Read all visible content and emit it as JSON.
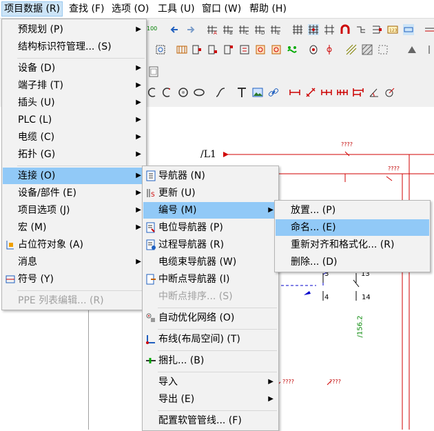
{
  "menubar": [
    {
      "label": "项目数据 (R)",
      "active": true
    },
    {
      "label": "查找 (F)"
    },
    {
      "label": "选项 (O)"
    },
    {
      "label": "工具 (U)"
    },
    {
      "label": "窗口 (W)"
    },
    {
      "label": "帮助 (H)"
    }
  ],
  "menu1": [
    {
      "label": "预规划 (P)",
      "sub": true
    },
    {
      "label": "结构标识符管理... (S)"
    },
    {
      "label": "设备 (D)",
      "sub": true
    },
    {
      "label": "端子排 (T)",
      "sub": true
    },
    {
      "label": "插头 (U)",
      "sub": true
    },
    {
      "label": "PLC (L)",
      "sub": true
    },
    {
      "label": "电缆 (C)",
      "sub": true
    },
    {
      "label": "拓扑 (G)",
      "sub": true
    },
    {
      "label": "连接 (O)",
      "sub": true,
      "highlighted": true
    },
    {
      "label": "设备/部件 (E)",
      "sub": true
    },
    {
      "label": "项目选项 (J)",
      "sub": true
    },
    {
      "label": "宏 (M)",
      "sub": true
    },
    {
      "label": "占位符对象 (A)",
      "icon": "placeholder-object-icon"
    },
    {
      "label": "消息",
      "sub": true
    },
    {
      "label": "符号 (Y)",
      "icon": "symbol-icon"
    },
    {
      "label": "PPE 列表编辑... (R)",
      "disabled": true
    }
  ],
  "menu2": [
    {
      "label": "导航器 (N)",
      "icon": "navigator-icon"
    },
    {
      "label": "更新 (U)",
      "icon": "update-icon"
    },
    {
      "label": "编号 (M)",
      "sub": true,
      "highlighted": true
    },
    {
      "label": "电位导航器 (P)",
      "icon": "potential-navigator-icon"
    },
    {
      "label": "过程导航器 (R)",
      "icon": "process-navigator-icon"
    },
    {
      "label": "电缆束导航器 (W)"
    },
    {
      "label": "中断点导航器 (I)",
      "icon": "interruption-point-icon"
    },
    {
      "label": "中断点排序... (S)",
      "disabled": true
    },
    {
      "label": "自动优化网络 (O)",
      "icon": "optimize-network-icon"
    },
    {
      "label": "布线(布局空间) (T)",
      "icon": "routing-icon"
    },
    {
      "label": "捆扎... (B)",
      "icon": "bundle-icon"
    },
    {
      "label": "导入",
      "sub": true
    },
    {
      "label": "导出 (E)",
      "sub": true
    },
    {
      "label": "配置软管管线... (F)"
    }
  ],
  "menu3": [
    {
      "label": "放置... (P)"
    },
    {
      "label": "命名... (E)",
      "highlighted": true
    },
    {
      "label": "重新对齐和格式化... (R)"
    },
    {
      "label": "删除... (D)"
    }
  ],
  "canvas": {
    "l1_label": "/L1",
    "placeholder_text": "????",
    "num_13": "13",
    "num_14": "14",
    "num_3": "3",
    "num_4": "4",
    "page_ref": "/156.2",
    "zoom_badge": "100"
  },
  "colors": {
    "highlight": "#91c9f7",
    "menu_bg": "#f2f2f2",
    "wire_red": "#d00000",
    "blue_dash": "#0000cc"
  }
}
